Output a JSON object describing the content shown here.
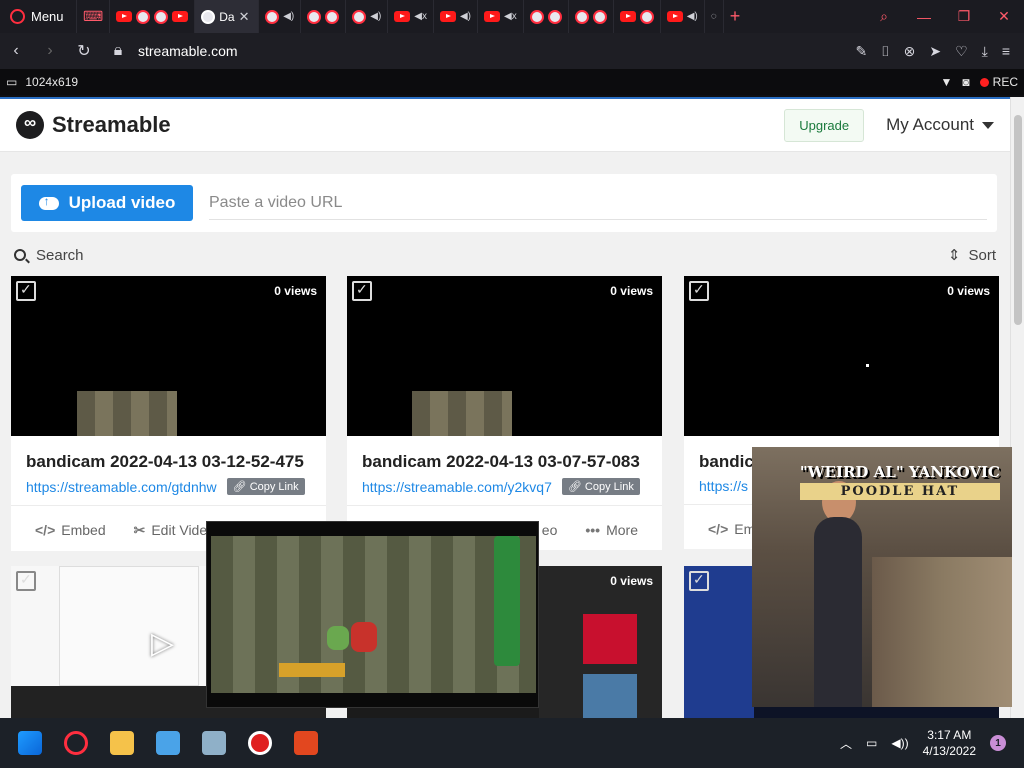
{
  "browser": {
    "menu_label": "Menu",
    "active_tab_label": "Da",
    "url": "streamable.com"
  },
  "recorder": {
    "resolution": "1024x619",
    "rec_label": "REC"
  },
  "site": {
    "brand": "Streamable",
    "upgrade_label": "Upgrade",
    "account_label": "My Account",
    "upload_label": "Upload video",
    "url_placeholder": "Paste a video URL",
    "search_label": "Search",
    "sort_label": "Sort"
  },
  "videos": [
    {
      "views": "0 views",
      "title": "bandicam 2022-04-13 03-12-52-475",
      "link": "https://streamable.com/gtdnhw",
      "copy_label": "Copy Link",
      "embed_label": "Embed",
      "edit_label": "Edit Vide"
    },
    {
      "views": "0 views",
      "title": "bandicam 2022-04-13 03-07-57-083",
      "link": "https://streamable.com/y2kvq7",
      "copy_label": "Copy Link",
      "edit_label": "eo",
      "more_label": "More"
    },
    {
      "views": "0 views",
      "title": "bandic",
      "link": "https://s",
      "embed_label": "Em"
    }
  ],
  "row2": {
    "views": "0 views"
  },
  "poster": {
    "line1": "\"WEIRD AL\" YANKOVIC",
    "line2": "POODLE HAT"
  },
  "taskbar": {
    "time": "3:17 AM",
    "date": "4/13/2022",
    "notification_count": "1"
  },
  "colors": {
    "accent_blue": "#1e88e5",
    "opera_red": "#ff2e3f",
    "upgrade_green": "#1a7a3c"
  }
}
